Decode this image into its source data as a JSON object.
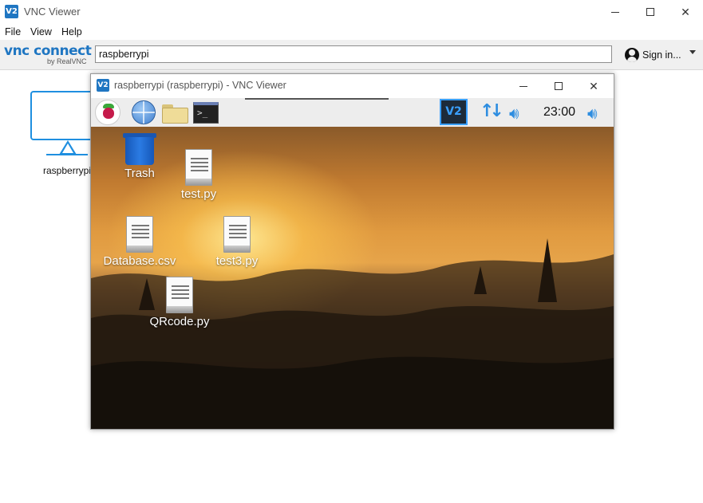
{
  "window": {
    "title": "VNC Viewer",
    "icon_text": "V2"
  },
  "menu": {
    "file": "File",
    "view": "View",
    "help": "Help"
  },
  "toolbar": {
    "brand_main": "vnc connect",
    "brand_sub": "by RealVNC",
    "address_value": "raspberrypi",
    "signin_label": "Sign in..."
  },
  "address_book": {
    "entry_label": "raspberrypi"
  },
  "session": {
    "title": "raspberrypi (raspberrypi) - VNC Viewer",
    "icon_text": "V2",
    "taskbar": {
      "clock": "23:00",
      "terminal_prompt": ">_",
      "vnc_tray_text": "V2"
    },
    "desktop_icons": [
      {
        "label": "Trash",
        "icon": "trash-icon"
      },
      {
        "label": "test.py",
        "icon": "file-icon"
      },
      {
        "label": "Database.csv",
        "icon": "file-icon"
      },
      {
        "label": "test3.py",
        "icon": "file-icon"
      },
      {
        "label": "QRcode.py",
        "icon": "file-icon"
      }
    ]
  },
  "colors": {
    "accent": "#1f76c2",
    "monitor": "#1f8fe0",
    "tray": "#2d8de0"
  }
}
